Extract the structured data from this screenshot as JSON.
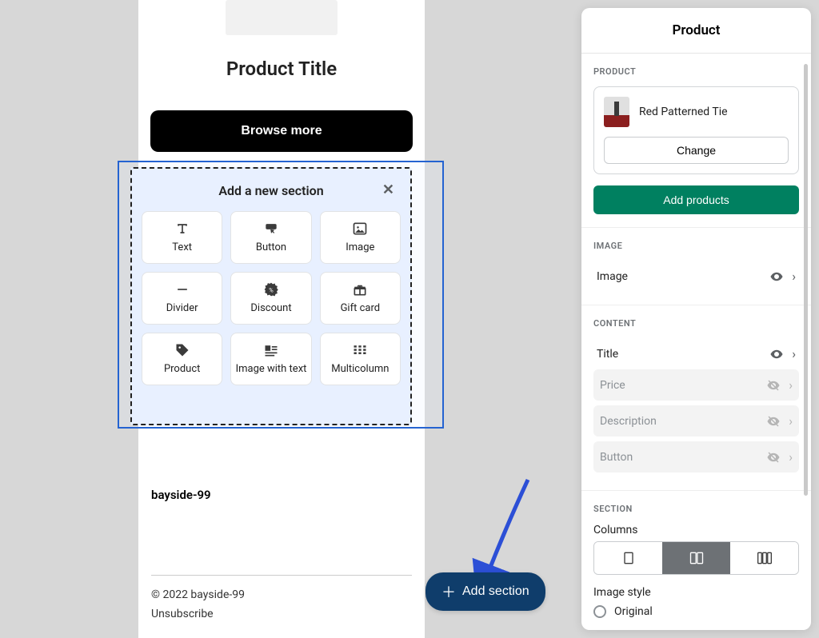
{
  "canvas": {
    "product_title": "Product Title",
    "browse_button": "Browse more"
  },
  "section_picker": {
    "title": "Add a new section",
    "tiles": [
      {
        "label": "Text",
        "icon": "text-icon"
      },
      {
        "label": "Button",
        "icon": "button-icon"
      },
      {
        "label": "Image",
        "icon": "image-icon"
      },
      {
        "label": "Divider",
        "icon": "divider-icon"
      },
      {
        "label": "Discount",
        "icon": "discount-icon"
      },
      {
        "label": "Gift card",
        "icon": "giftcard-icon"
      },
      {
        "label": "Product",
        "icon": "product-tag-icon"
      },
      {
        "label": "Image with text",
        "icon": "image-text-icon"
      },
      {
        "label": "Multicolumn",
        "icon": "multicolumn-icon"
      }
    ]
  },
  "footer": {
    "store_name": "bayside-99",
    "copyright": "© 2022 bayside-99",
    "unsubscribe": "Unsubscribe"
  },
  "fab": {
    "label": "Add section"
  },
  "panel": {
    "title": "Product",
    "sections": {
      "product": {
        "label": "PRODUCT",
        "selected_product_name": "Red Patterned Tie",
        "change_label": "Change",
        "add_products_label": "Add products"
      },
      "image": {
        "label": "IMAGE",
        "row_label": "Image"
      },
      "content": {
        "label": "CONTENT",
        "rows": [
          {
            "label": "Title",
            "visible": true
          },
          {
            "label": "Price",
            "visible": false
          },
          {
            "label": "Description",
            "visible": false
          },
          {
            "label": "Button",
            "visible": false
          }
        ]
      },
      "section": {
        "label": "SECTION",
        "columns_label": "Columns",
        "image_style_label": "Image style",
        "image_style_options": [
          "Original"
        ],
        "columns_selected_index": 1
      }
    }
  }
}
